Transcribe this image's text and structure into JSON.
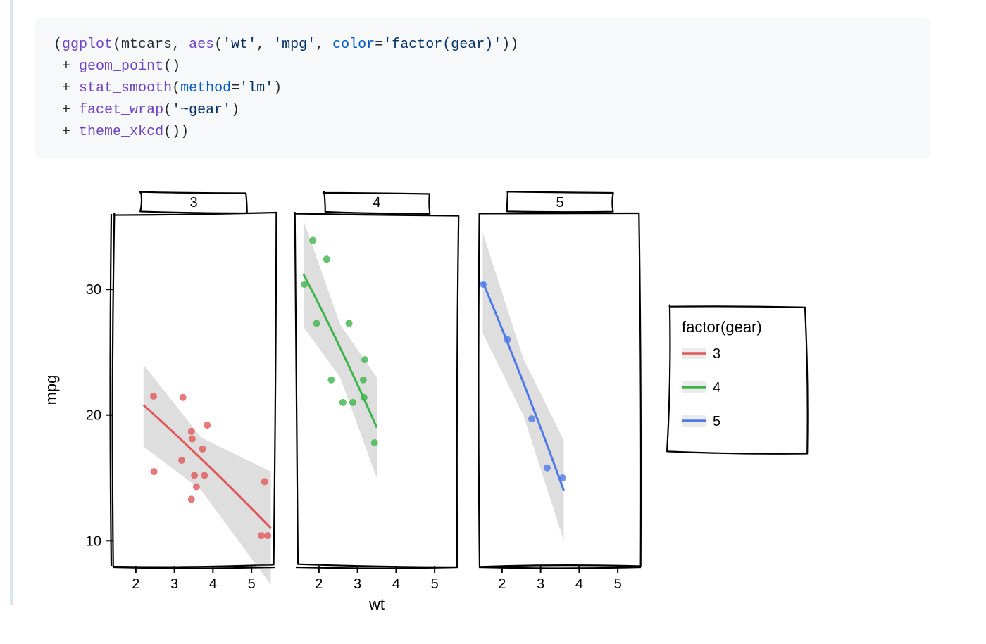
{
  "code": {
    "l1_fn": "ggplot",
    "l1_id": "mtcars",
    "l1_aes": "aes",
    "l1_s1": "'wt'",
    "l1_s2": "'mpg'",
    "l1_kw": "color",
    "l1_s3": "'factor(gear)'",
    "l2_fn": "geom_point",
    "l3_fn": "stat_smooth",
    "l3_kw": "method",
    "l3_s1": "'lm'",
    "l4_fn": "facet_wrap",
    "l4_s1": "'~gear'",
    "l5_fn": "theme_xkcd"
  },
  "chart_data": {
    "type": "scatter",
    "facet_var": "gear",
    "xlabel": "wt",
    "ylabel": "mpg",
    "x_ticks": [
      2,
      3,
      4,
      5
    ],
    "y_ticks": [
      10,
      20,
      30
    ],
    "xlim": [
      1.4,
      5.6
    ],
    "ylim": [
      8,
      36
    ],
    "legend_title": "factor(gear)",
    "legend_items": [
      {
        "label": "3",
        "color": "#e15759"
      },
      {
        "label": "4",
        "color": "#3cb44b"
      },
      {
        "label": "5",
        "color": "#4e79e7"
      }
    ],
    "facets": [
      {
        "label": "3",
        "color": "#e15759",
        "points": [
          {
            "x": 2.46,
            "y": 21.5
          },
          {
            "x": 3.22,
            "y": 21.4
          },
          {
            "x": 3.44,
            "y": 18.7
          },
          {
            "x": 3.46,
            "y": 18.1
          },
          {
            "x": 3.57,
            "y": 14.3
          },
          {
            "x": 3.19,
            "y": 16.4
          },
          {
            "x": 3.73,
            "y": 17.3
          },
          {
            "x": 3.78,
            "y": 15.2
          },
          {
            "x": 5.25,
            "y": 10.4
          },
          {
            "x": 5.42,
            "y": 10.4
          },
          {
            "x": 5.34,
            "y": 14.7
          },
          {
            "x": 2.47,
            "y": 15.5
          },
          {
            "x": 3.52,
            "y": 15.2
          },
          {
            "x": 3.44,
            "y": 13.3
          },
          {
            "x": 3.85,
            "y": 19.2
          }
        ],
        "fit": {
          "x0": 2.2,
          "y0": 20.8,
          "x1": 5.5,
          "y1": 11.0
        },
        "ci": [
          {
            "x": 2.2,
            "lo": 17.5,
            "hi": 24.0
          },
          {
            "x": 3.7,
            "lo": 14.0,
            "hi": 18.2
          },
          {
            "x": 5.5,
            "lo": 6.5,
            "hi": 15.5
          }
        ]
      },
      {
        "label": "4",
        "color": "#3cb44b",
        "points": [
          {
            "x": 2.62,
            "y": 21.0
          },
          {
            "x": 2.88,
            "y": 21.0
          },
          {
            "x": 2.32,
            "y": 22.8
          },
          {
            "x": 3.19,
            "y": 24.4
          },
          {
            "x": 3.15,
            "y": 22.8
          },
          {
            "x": 2.2,
            "y": 32.4
          },
          {
            "x": 1.62,
            "y": 30.4
          },
          {
            "x": 1.84,
            "y": 33.9
          },
          {
            "x": 2.78,
            "y": 27.3
          },
          {
            "x": 3.17,
            "y": 21.4
          },
          {
            "x": 1.94,
            "y": 27.3
          },
          {
            "x": 3.44,
            "y": 17.8
          }
        ],
        "fit": {
          "x0": 1.6,
          "y0": 31.2,
          "x1": 3.5,
          "y1": 19.0
        },
        "ci": [
          {
            "x": 1.6,
            "lo": 27.0,
            "hi": 35.5
          },
          {
            "x": 2.55,
            "lo": 23.0,
            "hi": 27.2
          },
          {
            "x": 3.5,
            "lo": 15.0,
            "hi": 23.0
          }
        ]
      },
      {
        "label": "5",
        "color": "#4e79e7",
        "points": [
          {
            "x": 2.14,
            "y": 26.0
          },
          {
            "x": 1.51,
            "y": 30.4
          },
          {
            "x": 3.17,
            "y": 15.8
          },
          {
            "x": 2.77,
            "y": 19.7
          },
          {
            "x": 3.57,
            "y": 15.0
          }
        ],
        "fit": {
          "x0": 1.5,
          "y0": 30.6,
          "x1": 3.6,
          "y1": 14.0
        },
        "ci": [
          {
            "x": 1.5,
            "lo": 26.5,
            "hi": 34.5
          },
          {
            "x": 2.55,
            "lo": 20.0,
            "hi": 24.5
          },
          {
            "x": 3.6,
            "lo": 10.0,
            "hi": 18.0
          }
        ]
      }
    ]
  }
}
